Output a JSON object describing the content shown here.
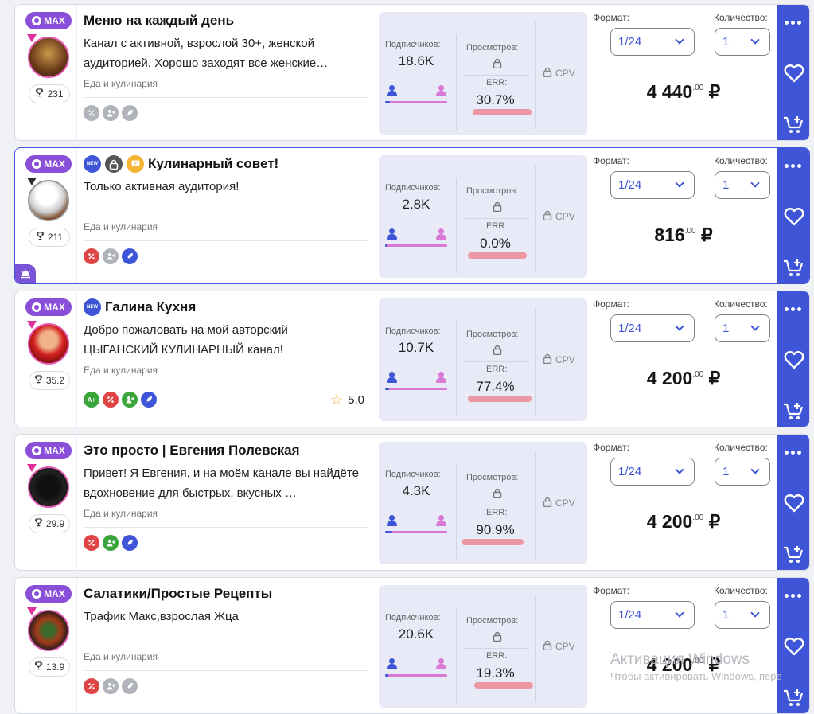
{
  "labels": {
    "max_badge": "MAX",
    "subscribers": "Подписчиков:",
    "views": "Просмотров:",
    "err": "ERR:",
    "cpv": "CPV",
    "format": "Формат:",
    "quantity": "Количество:",
    "new_tag": "NEW",
    "currency": "₽",
    "cents": ".00"
  },
  "colors": {
    "accent": "#3d55d6",
    "max_purple": "#8a4fd9",
    "err_highlight": "#eb8f9a",
    "stats_bg": "#e8ebf7"
  },
  "cards": [
    {
      "title": "Меню на каждый день",
      "tags": [],
      "description": "Канал с активной, взрослой 30+, женской аудиторией. Хорошо заходят все женские…",
      "category": "Еда и кулинария",
      "rating": "231",
      "chips": [
        "gray",
        "gray",
        "gray"
      ],
      "stars": null,
      "subscribers": "18.6K",
      "err": "30.7%",
      "male_share": 0.08,
      "format": "1/24",
      "quantity": "1",
      "price": "4 440",
      "avatar_icon": "food-photo-avatar",
      "highlight": false
    },
    {
      "title": "Кулинарный совет!",
      "tags": [
        "new",
        "lock",
        "msg"
      ],
      "description": "Только активная аудитория!",
      "category": "Еда и кулинария",
      "rating": "211",
      "chips": [
        "red",
        "gray",
        "blue"
      ],
      "stars": null,
      "subscribers": "2.8K",
      "err": "0.0%",
      "male_share": 0.03,
      "format": "1/24",
      "quantity": "1",
      "price": "816",
      "avatar_icon": "chef-avatar",
      "highlight": true
    },
    {
      "title": "Галина Кухня",
      "tags": [
        "new"
      ],
      "description": "Добро пожаловать на мой авторский ЦЫГАНСКИЙ КУЛИНАРНЫЙ канал!",
      "category": "Еда и кулинария",
      "rating": "35.2",
      "chips": [
        "ap",
        "red",
        "green",
        "blue"
      ],
      "stars": "5.0",
      "subscribers": "10.7K",
      "err": "77.4%",
      "male_share": 0.06,
      "format": "1/24",
      "quantity": "1",
      "price": "4 200",
      "avatar_icon": "woman-avatar",
      "highlight": false
    },
    {
      "title": "Это просто | Евгения Полевская",
      "tags": [],
      "description": "Привет! Я Евгения, и на моём канале вы найдёте вдохновение для быстрых, вкусных …",
      "category": "Еда и кулинария",
      "rating": "29.9",
      "chips": [
        "red",
        "green",
        "blue"
      ],
      "stars": null,
      "subscribers": "4.3K",
      "err": "90.9%",
      "male_share": 0.12,
      "format": "1/24",
      "quantity": "1",
      "price": "4 200",
      "avatar_icon": "logo-avatar",
      "highlight": false
    },
    {
      "title": "Салатики/Простые Рецепты",
      "tags": [],
      "description": "Трафик Макс,взрослая Жца",
      "category": "Еда и кулинария",
      "rating": "13.9",
      "chips": [
        "red",
        "gray",
        "gray"
      ],
      "stars": null,
      "subscribers": "20.6K",
      "err": "19.3%",
      "male_share": 0.05,
      "format": "1/24",
      "quantity": "1",
      "price": "4 200",
      "avatar_icon": "salad-avatar",
      "highlight": false
    }
  ],
  "watermark": {
    "title": "Активация Windows",
    "subtitle": "Чтобы активировать Windows, пере"
  }
}
